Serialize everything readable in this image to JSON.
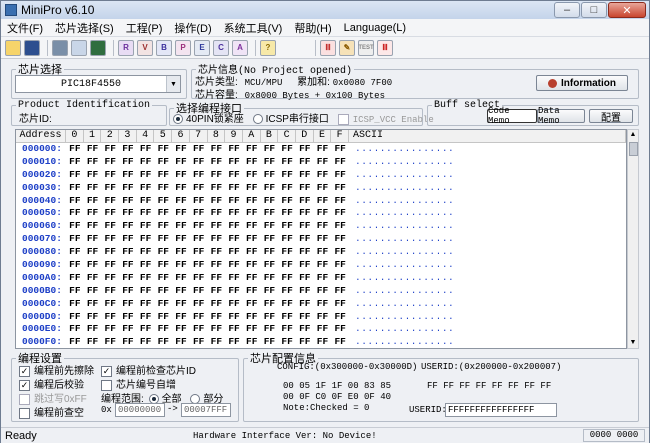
{
  "window": {
    "title": "MiniPro v6.10",
    "min": "–",
    "max": "□",
    "close": "✕"
  },
  "menu": [
    "文件(F)",
    "芯片选择(S)",
    "工程(P)",
    "操作(D)",
    "系统工具(V)",
    "帮助(H)",
    "Language(L)"
  ],
  "toolbar": [
    "open-icon",
    "save-icon",
    "load-icon",
    "reload-icon",
    "save-project-icon",
    "read-icon",
    "verify-icon",
    "blank-check-icon",
    "program-icon",
    "erase-icon",
    "config-icon",
    "auto-icon",
    "info-icon",
    "ic-test-icon",
    "chip-icon",
    "test-icon",
    "logic-icon"
  ],
  "chip_select": {
    "legend": "芯片选择",
    "value": "PIC18F4550",
    "arrow": "▼"
  },
  "chip_info": {
    "legend": "芯片信息(No Project opened)",
    "type_label": "芯片类型:",
    "type_val": "MCU/MPU",
    "checksum_label": "累加和:",
    "checksum_val": "0x0080 7F00",
    "size_label": "芯片容量:",
    "size_val": "0x8000 Bytes + 0x100 Bytes",
    "info_button": "Information"
  },
  "product": {
    "legend": "Product Identification",
    "id_label": "芯片ID:"
  },
  "interface": {
    "legend": "选择编程接口",
    "opt1": "40PIN锁紧座",
    "opt2": "ICSP串行接口",
    "opt3": "ICSP_VCC Enable"
  },
  "buff": {
    "legend": "Buff select",
    "code": "Code Memo",
    "data": "Data Memo",
    "config": "配置"
  },
  "grid": {
    "headers": [
      "Address",
      "0",
      "1",
      "2",
      "3",
      "4",
      "5",
      "6",
      "7",
      "8",
      "9",
      "A",
      "B",
      "C",
      "D",
      "E",
      "F",
      "ASCII"
    ],
    "cell": "FF",
    "ascii": "................",
    "rows": [
      "000000:",
      "000010:",
      "000020:",
      "000030:",
      "000040:",
      "000050:",
      "000060:",
      "000070:",
      "000080:",
      "000090:",
      "0000A0:",
      "0000B0:",
      "0000C0:",
      "0000D0:",
      "0000E0:",
      "0000F0:"
    ]
  },
  "prog_settings": {
    "legend": "编程设置",
    "opt_erase": "编程前先擦除",
    "opt_check_id": "编程前检查芯片ID",
    "opt_verify": "编程后校验",
    "opt_serial": "芯片编号自增",
    "opt_skip": "跳过写0xFF",
    "opt_blank": "编程前查空",
    "range_label": "编程范围:",
    "range_all": "全部",
    "range_part": "部分",
    "prefix": "0x",
    "from": "00000000",
    "to": "00007FFF",
    "arrow": "->"
  },
  "chip_config": {
    "legend": "芯片配置信息",
    "config_label": "CONFIG:(0x300000-0x30000D)",
    "config_line1": "00 05 1F 1F 00 83 85",
    "config_line2": "00 0F C0 0F E0 0F 40",
    "note": "Note:Checked = 0",
    "userid_label": "USERID:(0x200000-0x200007)",
    "userid_line": "FF FF FF FF FF FF FF FF",
    "userid_field_label": "USERID:",
    "userid_field": "FFFFFFFFFFFFFFFF"
  },
  "status": {
    "ready": "Ready",
    "hw": "Hardware Interface Ver: No Device!",
    "code": "0000 0000"
  }
}
